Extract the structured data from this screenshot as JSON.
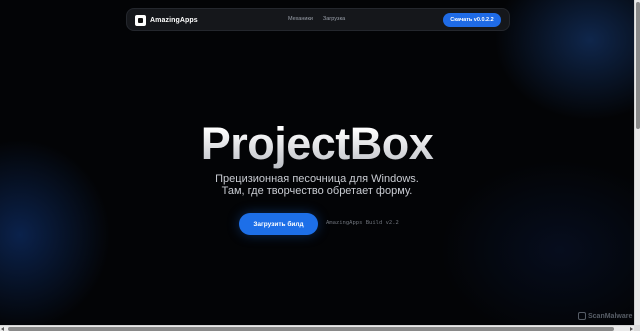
{
  "nav": {
    "brand": "AmazingApps",
    "brand_icon": "app-logo-icon",
    "links": [
      "Механики",
      "Загрузка"
    ],
    "download_label": "Скачать v0.0.2.2"
  },
  "hero": {
    "title": "ProjectBox",
    "subtitle_line1": "Прецизионная песочница для Windows.",
    "subtitle_line2": "Там, где творчество обретает форму.",
    "cta_label": "Загрузить билд",
    "build_info": "AmazingApps Build v2.2"
  },
  "watermark": {
    "text": "ScanMalware",
    "icon": "scanmalware-logo-icon"
  },
  "colors": {
    "accent": "#1d6fe8",
    "background": "#030406",
    "nav_background": "#15171b"
  }
}
